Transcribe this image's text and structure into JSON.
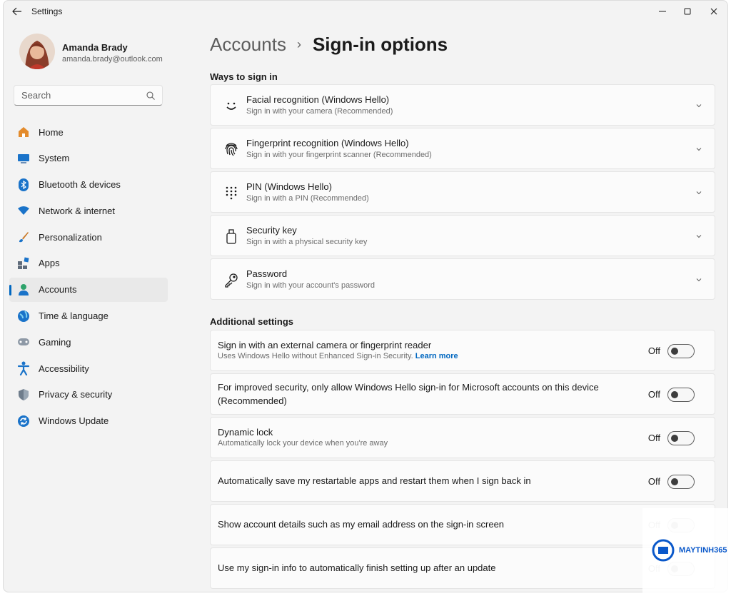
{
  "app": {
    "title": "Settings"
  },
  "user": {
    "name": "Amanda Brady",
    "email": "amanda.brady@outlook.com"
  },
  "search": {
    "placeholder": "Search"
  },
  "nav": [
    {
      "label": "Home",
      "icon": "home-icon",
      "active": false
    },
    {
      "label": "System",
      "icon": "system-icon",
      "active": false
    },
    {
      "label": "Bluetooth & devices",
      "icon": "bluetooth-icon",
      "active": false
    },
    {
      "label": "Network & internet",
      "icon": "wifi-icon",
      "active": false
    },
    {
      "label": "Personalization",
      "icon": "brush-icon",
      "active": false
    },
    {
      "label": "Apps",
      "icon": "apps-icon",
      "active": false
    },
    {
      "label": "Accounts",
      "icon": "accounts-icon",
      "active": true
    },
    {
      "label": "Time & language",
      "icon": "globe-icon",
      "active": false
    },
    {
      "label": "Gaming",
      "icon": "gamepad-icon",
      "active": false
    },
    {
      "label": "Accessibility",
      "icon": "accessibility-icon",
      "active": false
    },
    {
      "label": "Privacy & security",
      "icon": "shield-icon",
      "active": false
    },
    {
      "label": "Windows Update",
      "icon": "update-icon",
      "active": false
    }
  ],
  "breadcrumb": {
    "parent": "Accounts",
    "separator": "›",
    "current": "Sign-in options"
  },
  "ways": {
    "title": "Ways to sign in",
    "items": [
      {
        "title": "Facial recognition (Windows Hello)",
        "subtitle": "Sign in with your camera (Recommended)",
        "icon": "face-icon"
      },
      {
        "title": "Fingerprint recognition (Windows Hello)",
        "subtitle": "Sign in with your fingerprint scanner (Recommended)",
        "icon": "fingerprint-icon"
      },
      {
        "title": "PIN (Windows Hello)",
        "subtitle": "Sign in with a PIN (Recommended)",
        "icon": "pin-icon"
      },
      {
        "title": "Security key",
        "subtitle": "Sign in with a physical security key",
        "icon": "usb-key-icon"
      },
      {
        "title": "Password",
        "subtitle": "Sign in with your account's password",
        "icon": "key-icon"
      }
    ]
  },
  "additional": {
    "title": "Additional settings",
    "items": [
      {
        "title": "Sign in with an external camera or fingerprint reader",
        "subtitle": "Uses Windows Hello without Enhanced Sign-in Security.",
        "link": "Learn more",
        "state": "Off"
      },
      {
        "title": "For improved security, only allow Windows Hello sign-in for Microsoft accounts on this device",
        "title2": "(Recommended)",
        "state": "Off"
      },
      {
        "title": "Dynamic lock",
        "subtitle": "Automatically lock your device when you're away",
        "state": "Off"
      },
      {
        "title": "Automatically save my restartable apps and restart them when I sign back in",
        "state": "Off"
      },
      {
        "title": "Show account details such as my email address on the sign-in screen",
        "state": "Off"
      },
      {
        "title": "Use my sign-in info to automatically finish setting up after an update",
        "state": "Off"
      }
    ]
  },
  "watermark": {
    "name": "MAYTINH365"
  },
  "colors": {
    "accent": "#0067c0",
    "background": "#f3f3f3",
    "card": "#fbfbfb"
  }
}
